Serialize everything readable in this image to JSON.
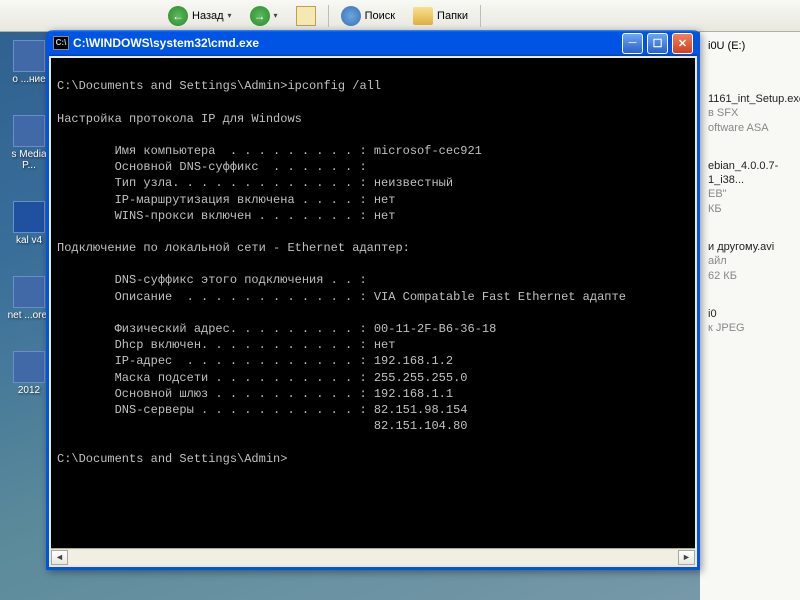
{
  "toolbar": {
    "back_label": "Назад",
    "search_label": "Поиск",
    "folders_label": "Папки",
    "history_glyph": "▾",
    "up_tip": "Вверх"
  },
  "desktop": {
    "icon1_label": "о ...ние",
    "icon2_label": "s Media P...",
    "icon3_label": "kal v4",
    "icon4_label": "net ...orer",
    "icon5_label": "2012"
  },
  "explorer": {
    "drive_label": "i0U (E:)",
    "file1_name": "1161_int_Setup.exe",
    "file1_type": "в SFX",
    "file1_vendor": "oftware ASA",
    "file2_name": "ebian_4.0.0.7-1_i38...",
    "file2_type": "EB\"",
    "file2_size": "КБ",
    "file3_name": "и другому.avi",
    "file3_type": "айл",
    "file3_size": "62 КБ",
    "file4_name": "i0",
    "file4_type": "к JPEG"
  },
  "cmd": {
    "window_title": "C:\\WINDOWS\\system32\\cmd.exe",
    "icon_glyph": "C:\\",
    "lines": [
      "",
      "C:\\Documents and Settings\\Admin>ipconfig /all",
      "",
      "Настройка протокола IP для Windows",
      "",
      "        Имя компьютера  . . . . . . . . . : microsof-cec921",
      "        Основной DNS-суффикс  . . . . . . :",
      "        Тип узла. . . . . . . . . . . . . : неизвестный",
      "        IP-маршрутизация включена . . . . : нет",
      "        WINS-прокси включен . . . . . . . : нет",
      "",
      "Подключение по локальной сети - Ethernet адаптер:",
      "",
      "        DNS-суффикс этого подключения . . :",
      "        Описание  . . . . . . . . . . . . : VIA Compatable Fast Ethernet адапте",
      "",
      "        Физический адрес. . . . . . . . . : 00-11-2F-B6-36-18",
      "        Dhcp включен. . . . . . . . . . . : нет",
      "        IP-адрес  . . . . . . . . . . . . : 192.168.1.2",
      "        Маска подсети . . . . . . . . . . : 255.255.255.0",
      "        Основной шлюз . . . . . . . . . . : 192.168.1.1",
      "        DNS-серверы . . . . . . . . . . . : 82.151.98.154",
      "                                            82.151.104.80",
      "",
      "C:\\Documents and Settings\\Admin>"
    ]
  },
  "glyph": {
    "minimize": "─",
    "maximize": "☐",
    "close": "✕",
    "left": "◄",
    "right": "►",
    "back": "←",
    "fwd": "→",
    "search": "🔍"
  }
}
